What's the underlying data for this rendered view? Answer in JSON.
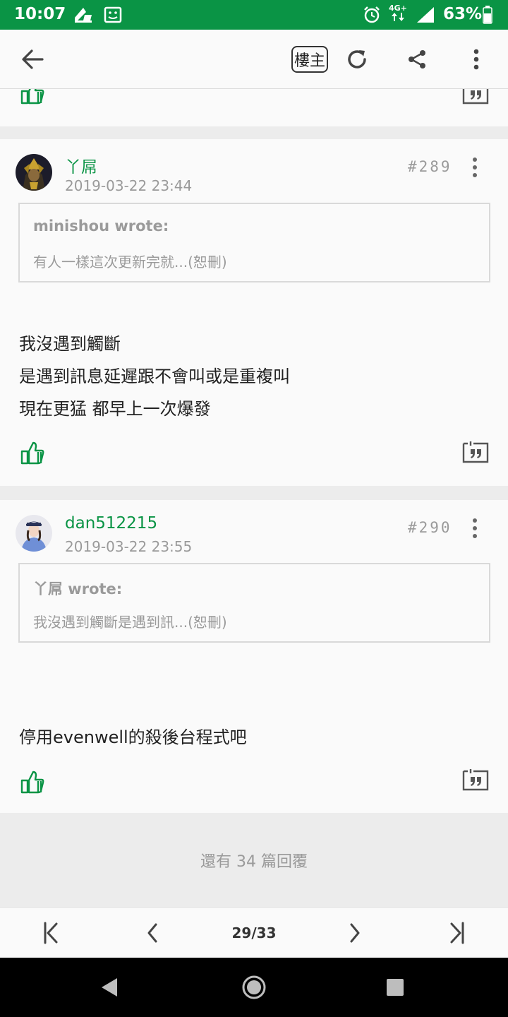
{
  "status_bar": {
    "time": "10:07",
    "network": "4G+",
    "battery": "63%",
    "icons": [
      "cleaner-icon",
      "screenshot-icon",
      "alarm-icon",
      "data-arrows-icon",
      "signal-icon",
      "battery-icon"
    ]
  },
  "app_bar": {
    "op_only_label": "樓主",
    "icons": [
      "back-arrow-icon",
      "refresh-icon",
      "share-icon",
      "more-vert-icon"
    ]
  },
  "posts": [
    {
      "author": "丫屌",
      "timestamp": "2019-03-22 23:44",
      "floor": "#289",
      "quote": {
        "author_line": "minishou wrote:",
        "text": "有人一樣這次更新完就...(恕刪)"
      },
      "lines": [
        "我沒遇到觸斷",
        "是遇到訊息延遲跟不會叫或是重複叫",
        "現在更猛 都早上一次爆發"
      ]
    },
    {
      "author": "dan512215",
      "timestamp": "2019-03-22 23:55",
      "floor": "#290",
      "quote": {
        "author_line": "丫屌 wrote:",
        "text": "我沒遇到觸斷是遇到訊...(恕刪)"
      },
      "lines": [
        "停用evenwell的殺後台程式吧"
      ]
    }
  ],
  "more_replies": "還有 34 篇回覆",
  "pager": {
    "label": "29/33",
    "current_page": 29,
    "total_pages": 33
  },
  "colors": {
    "brand_green": "#0a9445",
    "muted_text": "#9a9a9a",
    "background": "#ececec",
    "card": "#fafafa"
  }
}
